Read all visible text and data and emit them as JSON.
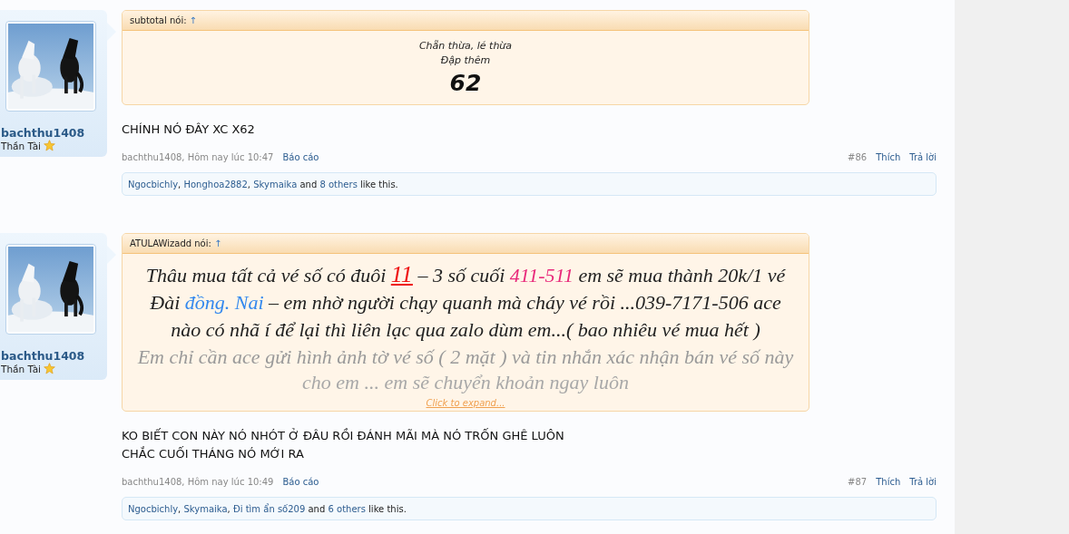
{
  "posts": [
    {
      "author": {
        "name": "bachthu1408",
        "title": "Thần Tài"
      },
      "quote": {
        "attribution": "subtotal nói:",
        "arrow": "↑",
        "kind": "centered",
        "lines": [
          {
            "kind": "small",
            "segments": [
              {
                "text": "Chẵn thừa, lé thừa",
                "kind": "plain"
              }
            ]
          },
          {
            "kind": "small",
            "segments": [
              {
                "text": "Đập thêm",
                "kind": "plain"
              }
            ]
          },
          {
            "kind": "big",
            "segments": [
              {
                "text": "62",
                "kind": "plain"
              }
            ]
          }
        ]
      },
      "message": [
        "CHÍNH NÓ ĐÂY XC X62"
      ],
      "byline": "bachthu1408, Hôm nay lúc 10:47",
      "report": "Báo cáo",
      "number": "#86",
      "like": "Thích",
      "reply": "Trả lời",
      "likes": [
        {
          "text": "Ngocbichly",
          "kind": "link"
        },
        {
          "text": ", ",
          "kind": "plain"
        },
        {
          "text": "Honghoa2882",
          "kind": "link"
        },
        {
          "text": ", ",
          "kind": "plain"
        },
        {
          "text": "Skymaika",
          "kind": "link"
        },
        {
          "text": " and ",
          "kind": "plain"
        },
        {
          "text": "8 others",
          "kind": "link"
        },
        {
          "text": " like this.",
          "kind": "plain"
        }
      ]
    },
    {
      "author": {
        "name": "bachthu1408",
        "title": "Thần Tài"
      },
      "quote": {
        "attribution": "ATULAWizadd nói:",
        "arrow": "↑",
        "kind": "expandable",
        "expand": "Click to expand...",
        "lines": [
          {
            "kind": "normal",
            "segments": [
              {
                "text": "Thâu mua tất cả vé số có đuôi ",
                "kind": "plain"
              },
              {
                "text": "11",
                "kind": "highlight",
                "color": "#ee1111"
              },
              {
                "text": " –  3 số cuối ",
                "kind": "plain"
              },
              {
                "text": "411-511",
                "kind": "colored",
                "color": "#e8287a"
              },
              {
                "text": " em sẽ mua thành 20k/1 vé",
                "kind": "plain"
              }
            ]
          },
          {
            "kind": "normal",
            "segments": [
              {
                "text": "Đài ",
                "kind": "plain"
              },
              {
                "text": "đồng. Nai",
                "kind": "colored",
                "color": "#3388ee"
              },
              {
                "text": "  –  em nhờ người chạy quanh mà cháy vé rồi ...039-7171-506 ace",
                "kind": "plain"
              }
            ]
          },
          {
            "kind": "normal",
            "segments": [
              {
                "text": "nào có nhã í để lại thì liên lạc qua zalo dùm em...( bao nhiêu vé mua hết )",
                "kind": "plain"
              }
            ]
          },
          {
            "kind": "faded",
            "segments": [
              {
                "text": "Em chỉ cần ace gửi hình ảnh tờ vé số ( 2 mặt ) và tin nhắn xác nhận bán vé số này",
                "kind": "plain"
              }
            ]
          },
          {
            "kind": "faint",
            "segments": [
              {
                "text": "cho em ... em sẽ chuyển khoản ngay luôn",
                "kind": "plain"
              }
            ]
          }
        ]
      },
      "message": [
        "KO BIẾT CON NÀY NÓ NHÓT Ở ĐÂU RỒI ĐÁNH MÃI MÀ NÓ TRỐN GHÊ LUÔN",
        "CHẮC CUỐI THÁNG NÓ MỚI RA"
      ],
      "byline": "bachthu1408, Hôm nay lúc 10:49",
      "report": "Báo cáo",
      "number": "#87",
      "like": "Thích",
      "reply": "Trả lời",
      "likes": [
        {
          "text": "Ngocbichly",
          "kind": "link"
        },
        {
          "text": ", ",
          "kind": "plain"
        },
        {
          "text": "Skymaika",
          "kind": "link"
        },
        {
          "text": ", ",
          "kind": "plain"
        },
        {
          "text": "Đi tìm ẩn số209",
          "kind": "link"
        },
        {
          "text": " and ",
          "kind": "plain"
        },
        {
          "text": "6 others",
          "kind": "link"
        },
        {
          "text": " like this.",
          "kind": "plain"
        }
      ]
    }
  ]
}
